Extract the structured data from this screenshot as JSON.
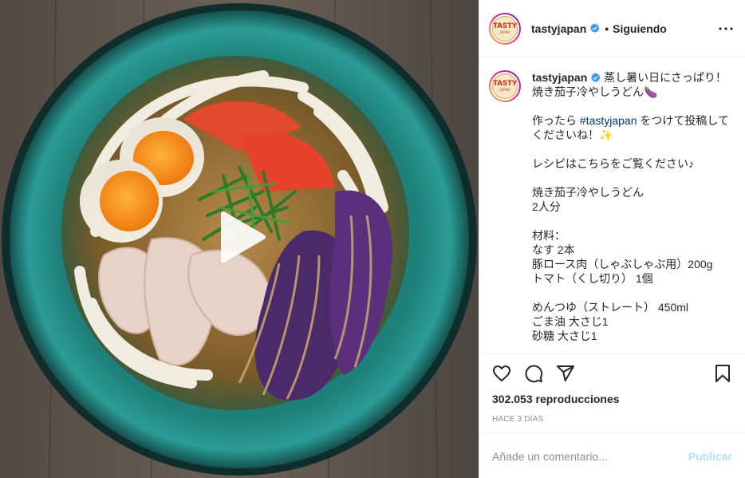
{
  "post": {
    "username": "tastyjapan",
    "follow_sep": "•",
    "follow_label": "Siguiendo",
    "avatar_logo_text": "TASTY",
    "avatar_logo_sub": "JAPAN"
  },
  "caption": {
    "username": "tastyjapan",
    "line1": " 蒸し暑い日にさっぱり！\n焼き茄子冷やしうどん🍆\n\n作ったら ",
    "hashtag": "#tastyjapan",
    "line2": " をつけて投稿してくださいね！✨\n\nレシピはこちらをご覧ください♪\n\n焼き茄子冷やしうどん\n2人分\n\n材料：\nなす 2本\n豚ロース肉（しゃぶしゃぶ用）200g\nトマト（くし切り） 1個\n\nめんつゆ（ストレート） 450ml\nごま油 大さじ1\n砂糖 大さじ1"
  },
  "stats": {
    "views": "302.053 reproducciones",
    "date": "HACE 3 DÍAS"
  },
  "comment_box": {
    "placeholder": "Añade un comentario...",
    "publish": "Publicar"
  },
  "icons": {
    "like": "heart-icon",
    "comment": "comment-icon",
    "share": "share-icon",
    "save": "bookmark-icon",
    "more": "more-icon",
    "play": "play-icon",
    "verified": "verified-badge-icon"
  },
  "colors": {
    "verified": "#3897f0",
    "publish_disabled": "#b2dffc",
    "hashtag": "#00376b"
  }
}
